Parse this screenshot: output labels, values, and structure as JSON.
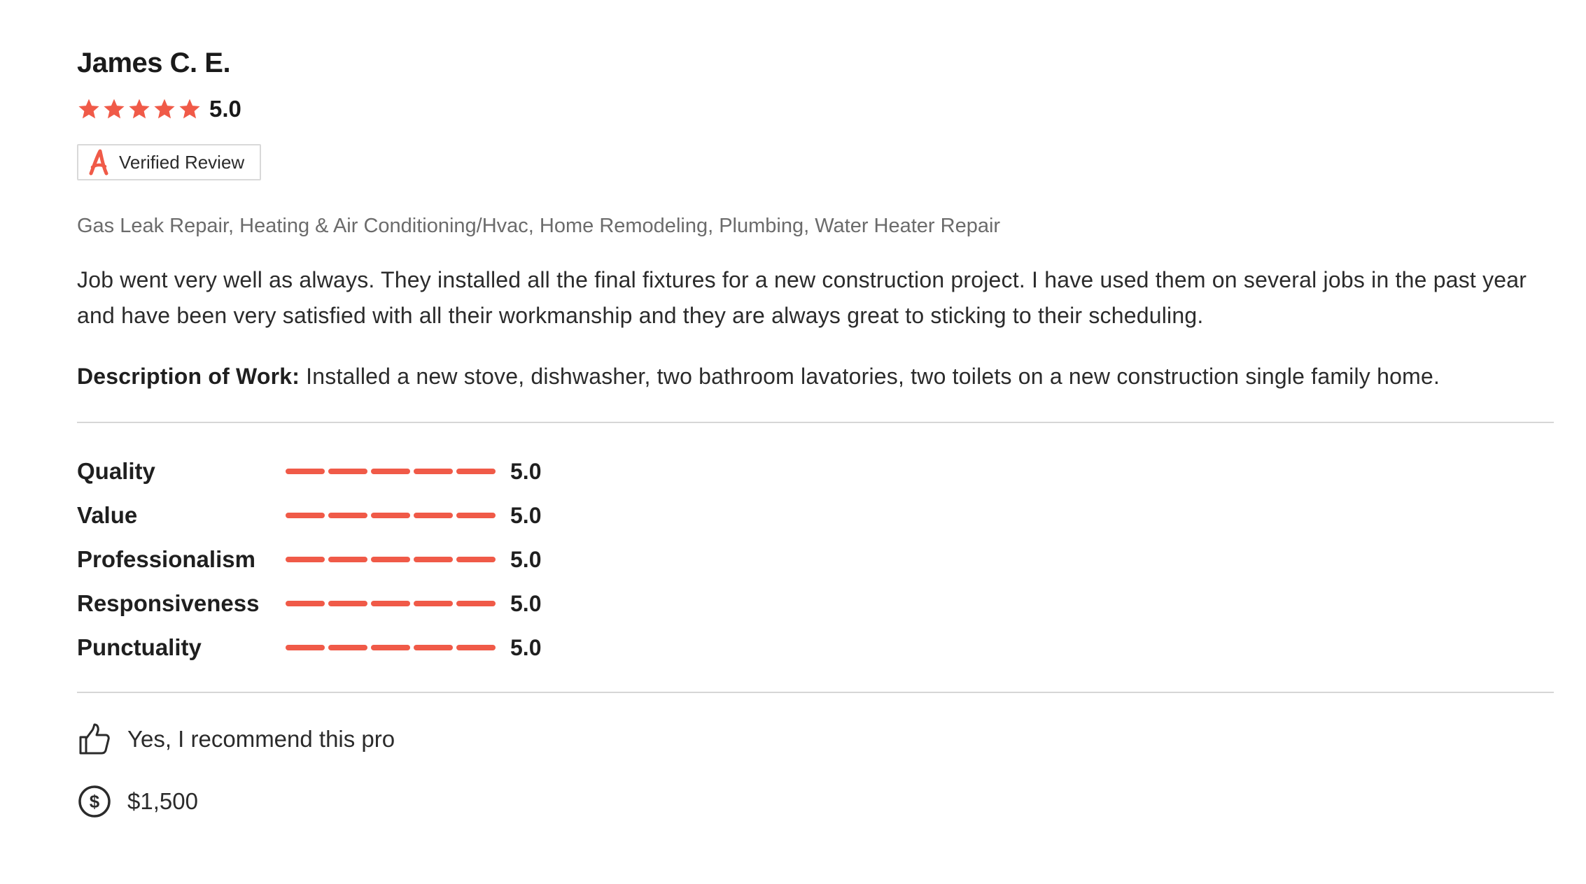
{
  "review": {
    "reviewer_name": "James C. E.",
    "rating": 5,
    "rating_display": "5.0",
    "star_count": 5,
    "badge": {
      "icon": "angi-logo-icon",
      "label": "Verified Review"
    },
    "categories": "Gas Leak Repair, Heating & Air Conditioning/Hvac, Home Remodeling, Plumbing, Water Heater Repair",
    "body": "Job went very well as always. They installed all the final fixtures for a new construction project. I have used them on several jobs in the past year and have been very satisfied with all their workmanship and they are always great to sticking to their scheduling.",
    "description_label": "Description of Work:",
    "description_text": " Installed a new stove, dishwasher, two bathroom lavatories, two toilets on a new construction single family home.",
    "metrics": [
      {
        "label": "Quality",
        "score": 5,
        "score_display": "5.0"
      },
      {
        "label": "Value",
        "score": 5,
        "score_display": "5.0"
      },
      {
        "label": "Professionalism",
        "score": 5,
        "score_display": "5.0"
      },
      {
        "label": "Responsiveness",
        "score": 5,
        "score_display": "5.0"
      },
      {
        "label": "Punctuality",
        "score": 5,
        "score_display": "5.0"
      }
    ],
    "metric_max": 5,
    "recommend": {
      "icon": "thumbs-up-icon",
      "text": "Yes, I recommend this pro"
    },
    "cost": {
      "icon": "dollar-circle-icon",
      "text": "$1,500"
    }
  },
  "colors": {
    "accent": "#f05a48",
    "text_primary": "#1f1f1f",
    "text_secondary": "#6b6b6b",
    "divider": "#d6d6d6"
  }
}
